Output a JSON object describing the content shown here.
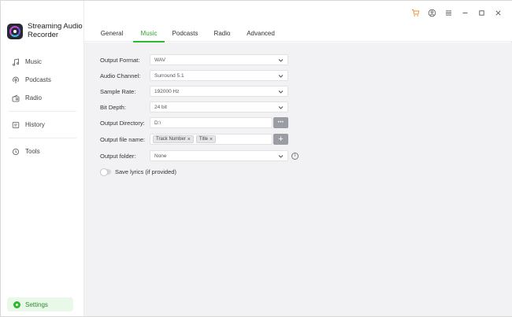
{
  "app": {
    "title": "Streaming Audio Recorder",
    "accent_color": "#2eb82e"
  },
  "sidebar": {
    "items": [
      {
        "label": "Music",
        "icon": "music-note-icon"
      },
      {
        "label": "Podcasts",
        "icon": "podcast-icon"
      },
      {
        "label": "Radio",
        "icon": "radio-icon"
      },
      {
        "label": "History",
        "icon": "history-icon"
      },
      {
        "label": "Tools",
        "icon": "tools-icon"
      }
    ],
    "settings_label": "Settings"
  },
  "titlebar": {
    "icons": [
      "cart-icon",
      "account-icon",
      "menu-icon",
      "minimize-icon",
      "maximize-icon",
      "close-icon"
    ]
  },
  "tabs": [
    {
      "label": "General",
      "active": false
    },
    {
      "label": "Music",
      "active": true
    },
    {
      "label": "Podcasts",
      "active": false
    },
    {
      "label": "Radio",
      "active": false
    },
    {
      "label": "Advanced",
      "active": false
    }
  ],
  "settings_form": {
    "output_format": {
      "label": "Output Format:",
      "value": "WAV"
    },
    "audio_channel": {
      "label": "Audio Channel:",
      "value": "Surround 5.1"
    },
    "sample_rate": {
      "label": "Sample Rate:",
      "value": "192000 Hz"
    },
    "bit_depth": {
      "label": "Bit Depth:",
      "value": "24 bit"
    },
    "output_directory": {
      "label": "Output Directory:",
      "value": "D:\\",
      "browse_label": "•••"
    },
    "output_file_name": {
      "label": "Output file name:",
      "chips": [
        "Track Number",
        "Title"
      ],
      "add_label": "+"
    },
    "output_folder": {
      "label": "Output folder:",
      "value": "None",
      "info_label": "i"
    },
    "save_lyrics": {
      "label": "Save lyrics (if provided)",
      "enabled": false
    }
  }
}
